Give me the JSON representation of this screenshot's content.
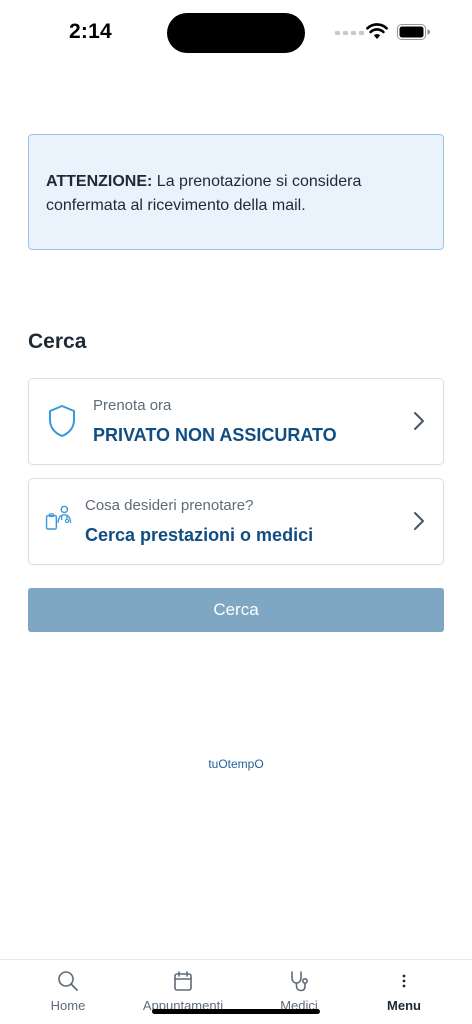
{
  "status_bar": {
    "time": "2:14"
  },
  "alert": {
    "label": "ATTENZIONE:",
    "message": " La prenotazione si considera confermata al ricevimento della mail."
  },
  "section_title": "Cerca",
  "cards": [
    {
      "subtitle": "Prenota ora",
      "title": "PRIVATO NON ASSICURATO",
      "icon": "shield-icon"
    },
    {
      "subtitle": "Cosa desideri prenotare?",
      "title": "Cerca prestazioni o medici",
      "icon": "doctor-clipboard-icon"
    }
  ],
  "search_button_label": "Cerca",
  "footer_link": "tuOtempO",
  "tabs": [
    {
      "label": "Home",
      "icon": "search-icon"
    },
    {
      "label": "Appuntamenti",
      "icon": "calendar-icon"
    },
    {
      "label": "Medici",
      "icon": "stethoscope-icon"
    },
    {
      "label": "Menu",
      "icon": "more-vertical-icon",
      "active": true
    }
  ],
  "colors": {
    "accent": "#0f4d82",
    "alert_bg": "#eaf2fc",
    "button_bg": "#7fa6c3"
  }
}
